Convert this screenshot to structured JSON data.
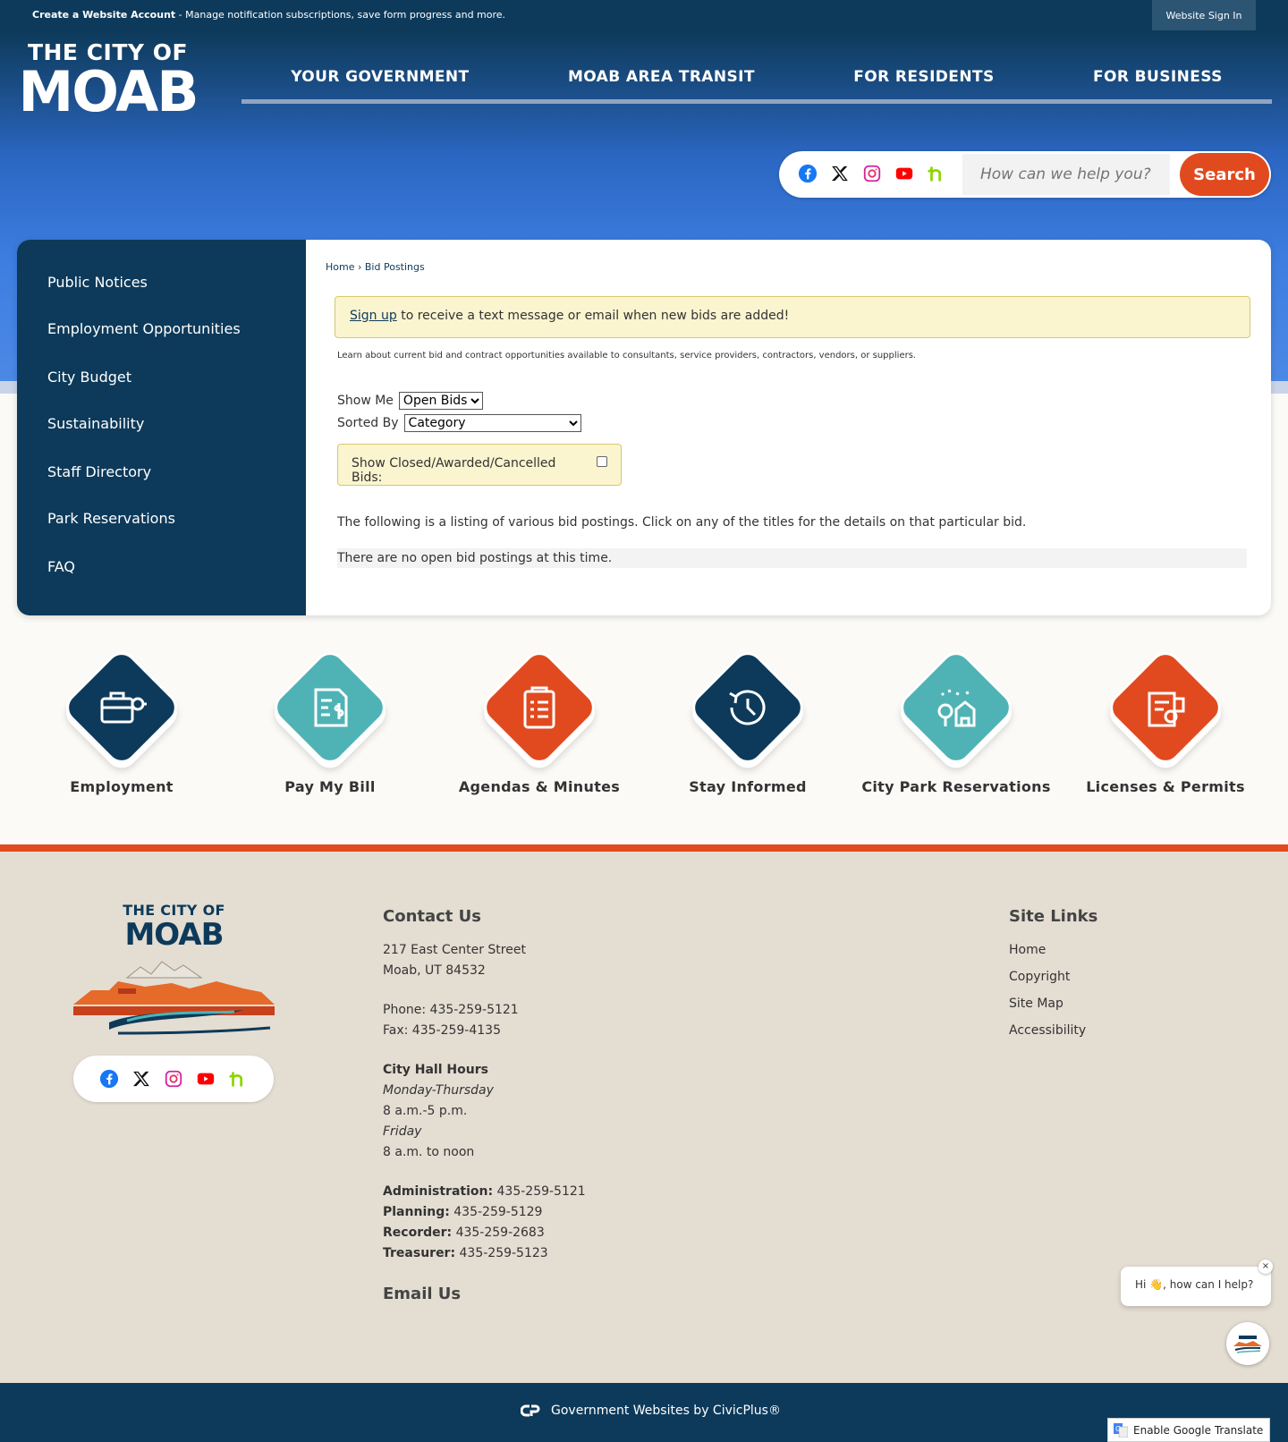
{
  "topbar": {
    "account_bold": "Create a Website Account",
    "account_rest": " - Manage notification subscriptions, save form progress and more.",
    "signin": "Website Sign In"
  },
  "logo": {
    "line1": "THE CITY OF",
    "line2": "MOAB"
  },
  "nav": [
    {
      "label": "YOUR GOVERNMENT"
    },
    {
      "label": "MOAB AREA TRANSIT"
    },
    {
      "label": "FOR RESIDENTS"
    },
    {
      "label": "FOR BUSINESS"
    }
  ],
  "search": {
    "placeholder": "How can we help you?",
    "button": "Search"
  },
  "social_icons": [
    "facebook-icon",
    "x-icon",
    "instagram-icon",
    "youtube-icon",
    "nextdoor-icon"
  ],
  "sidebar": {
    "items": [
      {
        "label": "Public Notices"
      },
      {
        "label": "Employment Opportunities"
      },
      {
        "label": "City Budget"
      },
      {
        "label": "Sustainability"
      },
      {
        "label": "Staff Directory"
      },
      {
        "label": "Park Reservations"
      },
      {
        "label": "FAQ"
      }
    ]
  },
  "breadcrumb": {
    "home": "Home",
    "sep": "›",
    "current": "Bid Postings"
  },
  "alert": {
    "link": "Sign up",
    "text": " to receive a text message or email when new bids are added!"
  },
  "description": "Learn about current bid and contract opportunities available to consultants, service providers, contractors, vendors, or suppliers.",
  "filters": {
    "show_me_label": "Show Me",
    "show_me_value": "Open Bids",
    "sorted_by_label": "Sorted By",
    "sorted_by_value": "Category",
    "closed_label": "Show Closed/Awarded/Cancelled Bids:"
  },
  "listing_text": "The following is a listing of various bid postings. Click on any of the titles for the details on that particular bid.",
  "empty_text": "There are no open bid postings at this time.",
  "quick_links": [
    {
      "label": "Employment",
      "color": "#0d3a5a",
      "icon": "briefcase-icon"
    },
    {
      "label": "Pay My Bill",
      "color": "#4fb3b5",
      "icon": "bill-icon"
    },
    {
      "label": "Agendas & Minutes",
      "color": "#e14a1f",
      "icon": "clipboard-icon"
    },
    {
      "label": "Stay Informed",
      "color": "#0d3a5a",
      "icon": "clock-icon"
    },
    {
      "label": "City Park Reservations",
      "color": "#4fb3b5",
      "icon": "park-icon"
    },
    {
      "label": "Licenses & Permits",
      "color": "#e14a1f",
      "icon": "permit-icon"
    }
  ],
  "footer": {
    "logo_line1": "THE CITY OF",
    "logo_line2": "MOAB",
    "contact_title": "Contact Us",
    "address1": "217 East Center Street",
    "address2": "Moab, UT 84532",
    "phone": "Phone: 435-259-5121",
    "fax": "Fax: 435-259-4135",
    "hours_title": "City Hall Hours",
    "days1": "Monday-Thursday",
    "time1": "8 a.m.-5 p.m.",
    "days2": "Friday",
    "time2": "8 a.m. to noon",
    "depts": [
      {
        "name": "Administration:",
        "phone": " 435-259-5121"
      },
      {
        "name": "Planning:",
        "phone": " 435-259-5129"
      },
      {
        "name": "Recorder:",
        "phone": " 435-259-2683"
      },
      {
        "name": "Treasurer:",
        "phone": " 435-259-5123"
      }
    ],
    "email": "Email Us",
    "links_title": "Site Links",
    "links": [
      {
        "label": "Home"
      },
      {
        "label": "Copyright"
      },
      {
        "label": "Site Map"
      },
      {
        "label": "Accessibility"
      }
    ]
  },
  "chat": {
    "greeting": "Hi 👋, how can I help?",
    "close": "×"
  },
  "bottom": {
    "credit": "Government Websites by CivicPlus®",
    "translate": "Enable Google Translate"
  },
  "colors": {
    "navy": "#0d3a5a",
    "orange": "#e14a1f",
    "teal": "#4fb3b5",
    "sand": "#e4ddd2"
  }
}
